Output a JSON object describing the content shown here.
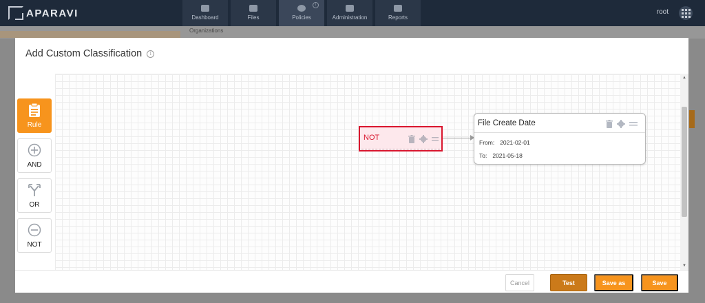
{
  "app": {
    "brand": "APARAVI",
    "nav_tabs": [
      {
        "label": "Dashboard",
        "icon": "dashboard-icon"
      },
      {
        "label": "Files",
        "icon": "folder-icon"
      },
      {
        "label": "Policies",
        "icon": "gear-icon",
        "active": true
      },
      {
        "label": "Administration",
        "icon": "users-icon"
      },
      {
        "label": "Reports",
        "icon": "clipboard-icon"
      }
    ],
    "user": "root",
    "breadcrumb": "Organizations"
  },
  "modal": {
    "title": "Add Custom Classification",
    "palette": [
      {
        "label": "Rule",
        "icon": "clipboard-icon",
        "active": true
      },
      {
        "label": "AND",
        "icon": "plus-circle-icon"
      },
      {
        "label": "OR",
        "icon": "split-arrows-icon"
      },
      {
        "label": "NOT",
        "icon": "minus-circle-icon"
      }
    ],
    "nodes": {
      "not_node": {
        "label": "NOT",
        "selected": true
      },
      "date_node": {
        "title": "File Create Date",
        "from_label": "From:",
        "from_value": "2021-02-01",
        "to_label": "To:",
        "to_value": "2021-05-18"
      }
    },
    "buttons": {
      "cancel": "Cancel",
      "test": "Test",
      "save_as": "Save as",
      "save": "Save"
    }
  },
  "colors": {
    "accent": "#f7941d",
    "selected_border": "#d9162e",
    "nav_bg": "#1e2a3a"
  }
}
